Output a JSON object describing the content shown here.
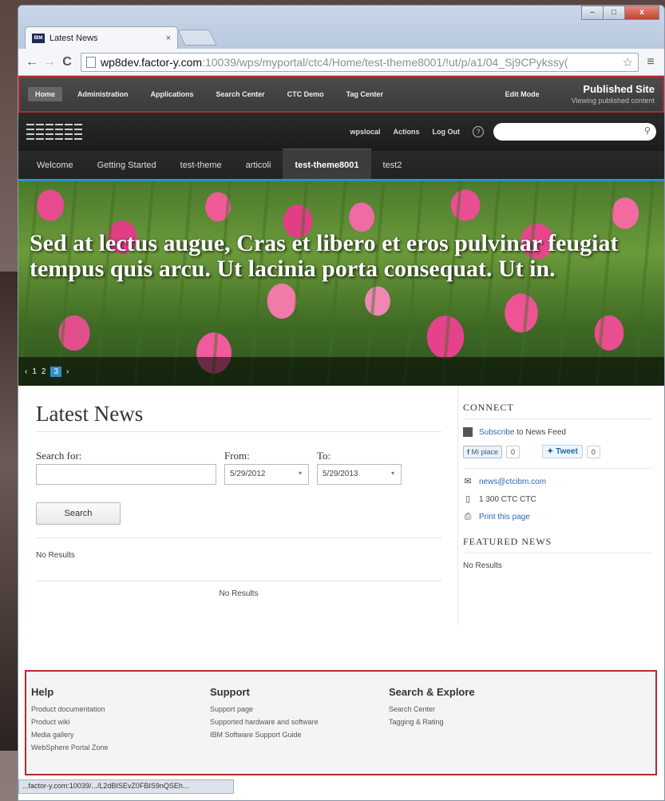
{
  "browser": {
    "tab_title": "Latest News",
    "tab_close": "×",
    "url_host": "wp8dev.factor-y.com",
    "url_path": ":10039/wps/myportal/ctc4/Home/test-theme8001/!ut/p/a1/04_Sj9CPykssy(",
    "status_url": "...factor-y.com:10039/.../L2dBISEvZ0FBIS9nQSEh...",
    "win_min": "–",
    "win_max": "□",
    "win_close": "x"
  },
  "portal_bar": {
    "items": [
      "Home",
      "Administration",
      "Applications",
      "Search Center",
      "CTC Demo",
      "Tag Center"
    ],
    "edit_mode": "Edit Mode",
    "published_title": "Published Site",
    "published_sub": "Viewing published content"
  },
  "masthead": {
    "user": "wpslocal",
    "actions": "Actions",
    "logout": "Log Out",
    "help": "?"
  },
  "page_nav": [
    "Welcome",
    "Getting Started",
    "test-theme",
    "articoli",
    "test-theme8001",
    "test2"
  ],
  "hero": {
    "headline": "Sed at lectus augue, Cras et libero et eros pulvinar feugiat tempus quis arcu. Ut lacinia porta consequat. Ut in.",
    "pager": [
      "‹",
      "1",
      "2",
      "3",
      "›"
    ],
    "active_page": 3
  },
  "news": {
    "title": "Latest News",
    "search_label": "Search for:",
    "from_label": "From:",
    "to_label": "To:",
    "from_value": "5/29/2012",
    "to_value": "5/29/2013",
    "search_button": "Search",
    "no_results_top": "No Results",
    "no_results_bottom": "No Results"
  },
  "sidebar": {
    "connect_title": "CONNECT",
    "subscribe_link": "Subscribe",
    "subscribe_rest": " to News Feed",
    "fb_label": "Mi piace",
    "fb_count": "0",
    "tweet_label": "Tweet",
    "tweet_count": "0",
    "email": "news@ctcibm.com",
    "phone": "1 300 CTC CTC",
    "print": "Print this page",
    "featured_title": "FEATURED NEWS",
    "featured_empty": "No Results"
  },
  "footer": {
    "columns": [
      {
        "title": "Help",
        "links": [
          "Product documentation",
          "Product wiki",
          "Media gallery",
          "WebSphere Portal Zone"
        ]
      },
      {
        "title": "Support",
        "links": [
          "Support page",
          "Supported hardware and software",
          "IBM Software Support Guide"
        ]
      },
      {
        "title": "Search & Explore",
        "links": [
          "Search Center",
          "Tagging & Rating"
        ]
      }
    ]
  },
  "colors": {
    "highlight_border": "#b52a2a",
    "accent_blue": "#2f8ec8",
    "portal_bar_bg": "#3a3a3a"
  },
  "icons": {
    "back": "back-arrow-icon",
    "forward": "forward-arrow-icon",
    "reload": "reload-icon",
    "star": "bookmark-star-icon",
    "menu": "chrome-menu-icon",
    "search": "search-icon",
    "rss": "rss-icon",
    "email": "email-icon",
    "phone": "phone-icon",
    "print": "printer-icon"
  }
}
